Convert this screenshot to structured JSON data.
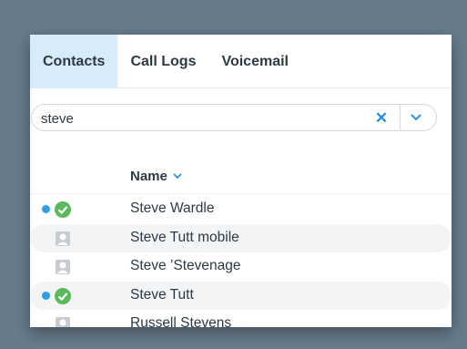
{
  "tabs": [
    {
      "label": "Contacts",
      "active": true
    },
    {
      "label": "Call Logs",
      "active": false
    },
    {
      "label": "Voicemail",
      "active": false
    }
  ],
  "search": {
    "value": "steve",
    "clear_icon": "close-icon",
    "dropdown_icon": "chevron-down-icon"
  },
  "list_header": {
    "label": "Name",
    "sort_icon": "chevron-down-icon"
  },
  "contacts": [
    {
      "name": "Steve Wardle",
      "online": true,
      "status": "available"
    },
    {
      "name": "Steve Tutt mobile",
      "online": false,
      "status": "unknown"
    },
    {
      "name": "Steve ’Stevenage",
      "online": false,
      "status": "unknown"
    },
    {
      "name": "Steve Tutt",
      "online": true,
      "status": "available"
    },
    {
      "name": "Russell Stevens",
      "online": false,
      "status": "unknown"
    }
  ],
  "colors": {
    "background": "#677b8a",
    "active_tab": "#d7ebf8",
    "accent": "#2a8de0",
    "presence_dot": "#2f9fe8",
    "available_green": "#5cb85c",
    "unknown_gray": "#c8ccd0"
  }
}
